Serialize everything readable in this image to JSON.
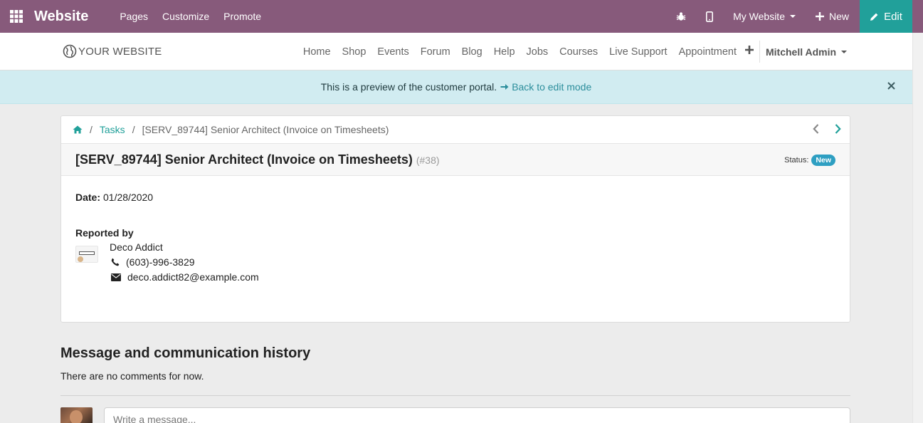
{
  "topbar": {
    "brand": "Website",
    "menu": [
      "Pages",
      "Customize",
      "Promote"
    ],
    "website_selector": "My Website",
    "new_label": "New",
    "edit_label": "Edit",
    "color": "#875a7b",
    "edit_color": "#21a09a"
  },
  "site": {
    "logo_text": "YOUR WEBSITE",
    "nav": [
      "Home",
      "Shop",
      "Events",
      "Forum",
      "Blog",
      "Help",
      "Jobs",
      "Courses",
      "Live Support",
      "Appointment"
    ],
    "user": "Mitchell Admin"
  },
  "alert": {
    "text": "This is a preview of the customer portal.",
    "link": "Back to edit mode"
  },
  "breadcrumb": {
    "tasks": "Tasks",
    "sep": "/",
    "current": "[SERV_89744] Senior Architect (Invoice on Timesheets)"
  },
  "task": {
    "title": "[SERV_89744] Senior Architect (Invoice on Timesheets)",
    "ref": "(#38)",
    "status_label": "Status:",
    "status": "New",
    "status_color": "#2e9fc2",
    "date_label": "Date:",
    "date": "01/28/2020",
    "reported_by_label": "Reported by",
    "contact": {
      "name": "Deco Addict",
      "phone": "(603)-996-3829",
      "email": "deco.addict82@example.com"
    }
  },
  "history": {
    "title": "Message and communication history",
    "empty": "There are no comments for now.",
    "input_placeholder": "Write a message..."
  }
}
